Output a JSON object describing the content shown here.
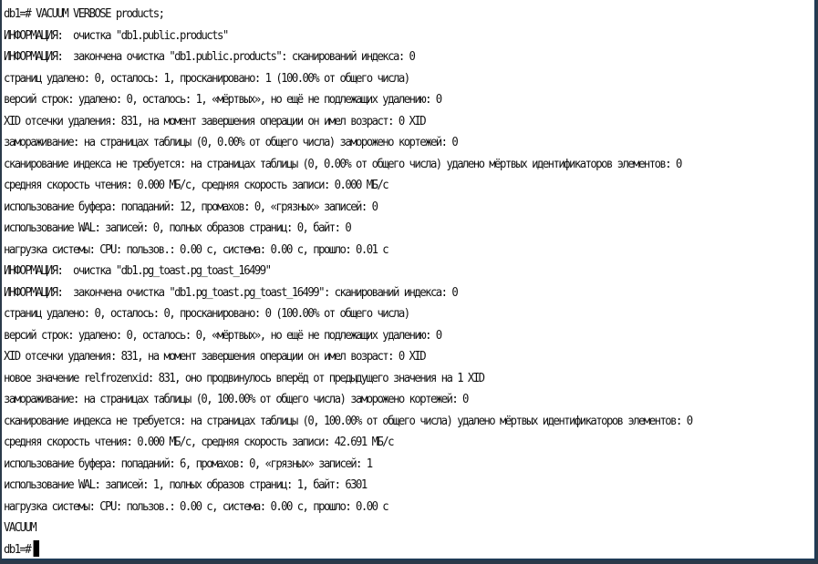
{
  "terminal": {
    "lines": [
      "db1=# VACUUM VERBOSE products;",
      "ИНФОРМАЦИЯ:  очистка \"db1.public.products\"",
      "ИНФОРМАЦИЯ:  закончена очистка \"db1.public.products\": сканирований индекса: 0",
      "страниц удалено: 0, осталось: 1, просканировано: 1 (100.00% от общего числа)",
      "версий строк: удалено: 0, осталось: 1, «мёртвых», но ещё не подлежащих удалению: 0",
      "XID отсечки удаления: 831, на момент завершения операции он имел возраст: 0 XID",
      "замораживание: на страницах таблицы (0, 0.00% от общего числа) заморожено кортежей: 0",
      "сканирование индекса не требуется: на страницах таблицы (0, 0.00% от общего числа) удалено мёртвых идентификаторов элементов: 0",
      "средняя скорость чтения: 0.000 МБ/с, средняя скорость записи: 0.000 МБ/с",
      "использование буфера: попаданий: 12, промахов: 0, «грязных» записей: 0",
      "использование WAL: записей: 0, полных образов страниц: 0, байт: 0",
      "нагрузка системы: CPU: пользов.: 0.00 с, система: 0.00 с, прошло: 0.01 с",
      "ИНФОРМАЦИЯ:  очистка \"db1.pg_toast.pg_toast_16499\"",
      "ИНФОРМАЦИЯ:  закончена очистка \"db1.pg_toast.pg_toast_16499\": сканирований индекса: 0",
      "страниц удалено: 0, осталось: 0, просканировано: 0 (100.00% от общего числа)",
      "версий строк: удалено: 0, осталось: 0, «мёртвых», но ещё не подлежащих удалению: 0",
      "XID отсечки удаления: 831, на момент завершения операции он имел возраст: 0 XID",
      "новое значение relfrozenxid: 831, оно продвинулось вперёд от предыдущего значения на 1 XID",
      "замораживание: на страницах таблицы (0, 100.00% от общего числа) заморожено кортежей: 0",
      "сканирование индекса не требуется: на страницах таблицы (0, 100.00% от общего числа) удалено мёртвых идентификаторов элементов: 0",
      "средняя скорость чтения: 0.000 МБ/с, средняя скорость записи: 42.691 МБ/с",
      "использование буфера: попаданий: 6, промахов: 0, «грязных» записей: 1",
      "использование WAL: записей: 1, полных образов страниц: 1, байт: 6301",
      "нагрузка системы: CPU: пользов.: 0.00 с, система: 0.00 с, прошло: 0.00 с",
      "VACUUM"
    ],
    "prompt": "db1=#"
  }
}
